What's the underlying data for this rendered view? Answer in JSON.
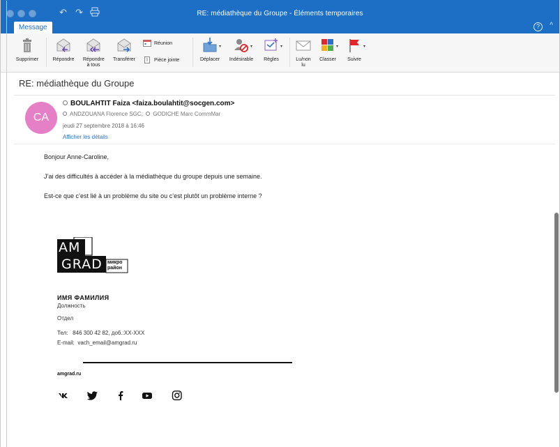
{
  "window": {
    "title": "RE: médiathèque du Groupe - Éléments temporaires",
    "tab": "Message",
    "help_symbol": "?",
    "collapse_symbol": "^"
  },
  "ribbon": {
    "delete": "Supprimer",
    "reply": "Répondre",
    "reply_all": "Répondre à tous",
    "forward": "Transférer",
    "meeting": "Réunion",
    "attachment": "Pièce jointe",
    "move": "Déplacer",
    "junk": "Indésirable",
    "rules": "Règles",
    "read_unread": "Lu/non lu",
    "categorize": "Classer",
    "follow_up": "Suivre"
  },
  "message": {
    "subject": "RE: médiathèque du Groupe",
    "avatar_initials": "CA",
    "avatar_color": "#e680c6",
    "sender": "BOULAHTIT Faiza <faiza.boulahtit@socgen.com>",
    "recipient_1": "ANDZOUANA Florence SGC;",
    "recipient_2": "GODICHE Marc CommMar",
    "date": "jeudi 27 septembre 2018 à 16:46",
    "show_details": "Afficher les détails",
    "greeting": "Bonjour Anne-Caroline,",
    "paragraph_1": "J’ai des difficultés à accéder à la médiathèque du groupe depuis une semaine.",
    "paragraph_2": "Est-ce que c’est lié à un problème du site ou c’est plutôt un problème interne ?"
  },
  "signature": {
    "logo_line_1": "AM",
    "logo_line_2": "GRAD",
    "logo_tag_1": "микро",
    "logo_tag_2": "район",
    "name": "ИМЯ ФАМИЛИЯ",
    "position": "Должность",
    "department": "Отдел",
    "phone": "Тел:   846 300 42 82, доб.:XX-XXX",
    "email": "E-mail:  vach_email@amgrad.ru",
    "website": "amgrad.ru",
    "social_icons": [
      "vk-icon",
      "twitter-icon",
      "facebook-icon",
      "youtube-icon",
      "instagram-icon"
    ]
  },
  "colors": {
    "titlebar": "#1c6fc4",
    "link": "#2a72c8",
    "follow_flag": "#e0262c"
  }
}
